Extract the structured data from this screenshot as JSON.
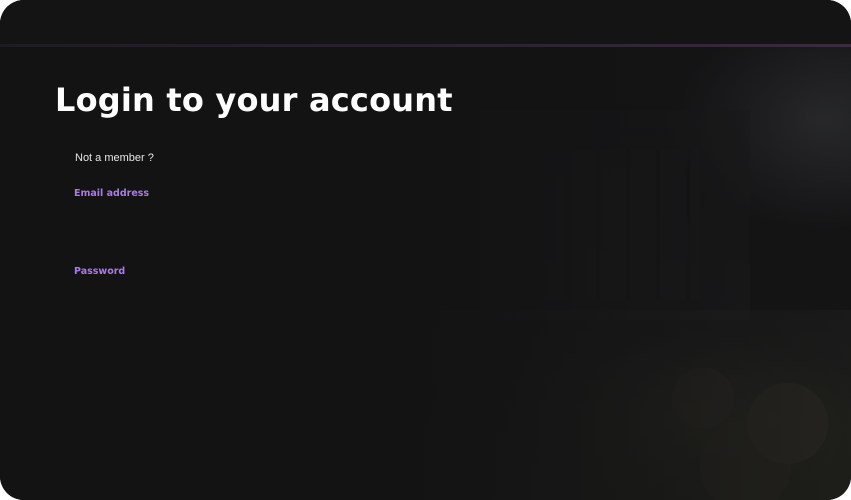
{
  "login": {
    "title": "Login to your account",
    "not_member_text": "Not a member ?",
    "email": {
      "label": "Email address",
      "value": "",
      "placeholder": ""
    },
    "password": {
      "label": "Password",
      "value": "",
      "placeholder": ""
    }
  },
  "colors": {
    "background": "#131314",
    "title_text": "#ffffff",
    "label_accent": "#a97be8"
  }
}
